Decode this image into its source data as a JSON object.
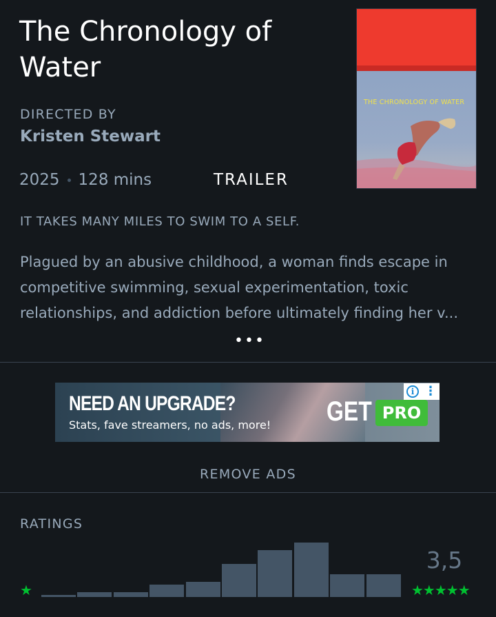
{
  "film": {
    "title": "The Chronology of Water",
    "directed_by_label": "DIRECTED BY",
    "director": "Kristen Stewart",
    "year": "2025",
    "runtime": "128 mins",
    "trailer_label": "TRAILER",
    "tagline": "IT TAKES MANY MILES TO SWIM TO A SELF.",
    "synopsis": "Plagued by an abusive childhood, a woman finds escape in competitive swimming, sexual experimentation, toxic relationships, and addiction before ultimately finding her v...",
    "more_label": "•••"
  },
  "poster": {
    "title_text": "THE CHRONOLOGY OF WATER",
    "colors": {
      "top": "#ee3a2e",
      "bottom": "#8fa4c4",
      "title": "#f2e24a"
    }
  },
  "ad": {
    "headline": "NEED AN UPGRADE?",
    "subline": "Stats, fave streamers, no ads, more!",
    "get": "GET",
    "pro": "PRO",
    "info_icon": "info-icon",
    "menu_icon": "kebab-icon"
  },
  "remove_ads_label": "REMOVE ADS",
  "ratings": {
    "label": "RATINGS",
    "average": "3,5",
    "min_stars": "★",
    "max_stars": "★★★★★",
    "star_color": "#00c030",
    "bar_color": "#445566"
  },
  "chart_data": {
    "type": "bar",
    "categories": [
      "½",
      "1",
      "1½",
      "2",
      "2½",
      "3",
      "3½",
      "4",
      "4½",
      "5"
    ],
    "values": [
      3,
      7,
      7,
      18,
      22,
      48,
      68,
      79,
      33,
      33
    ],
    "ylim": [
      0,
      79
    ]
  }
}
